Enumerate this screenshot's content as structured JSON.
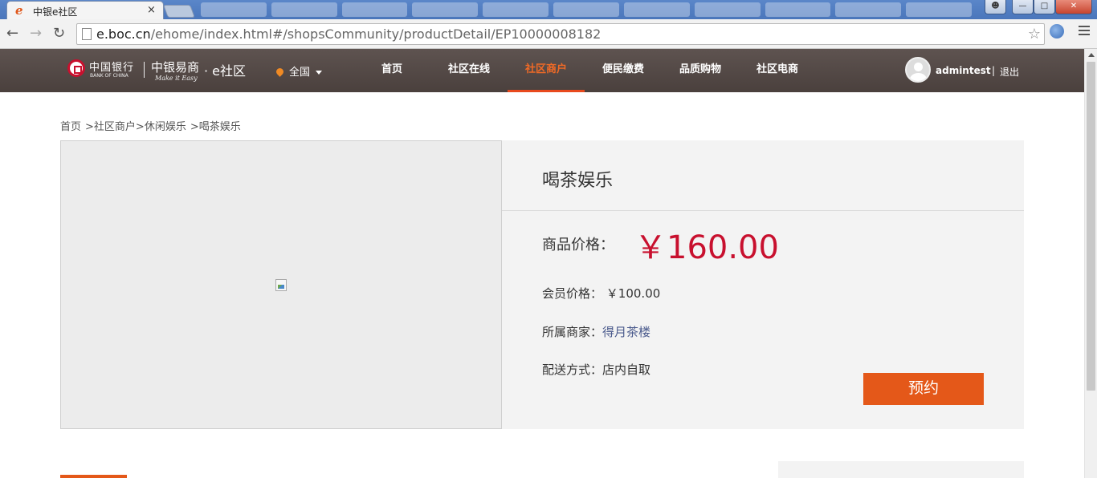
{
  "browser": {
    "tab_title": "中银e社区",
    "tab_favicon": "e",
    "tab_close": "×",
    "url_host": "e.boc.cn",
    "url_path": "/ehome/index.html#/shopsCommunity/productDetail/EP10000008182"
  },
  "header": {
    "bank_name": "中国银行",
    "bank_en": "BANK OF CHINA",
    "brand_zh": "中银易商",
    "brand_en": "Make it Easy",
    "brand_suffix": "· e社区",
    "location": "全国",
    "nav": [
      "首页",
      "社区在线",
      "社区商户",
      "便民缴费",
      "品质购物",
      "社区电商"
    ],
    "active_nav": "社区商户",
    "username": "admintest",
    "separator": "|",
    "logout": "退出"
  },
  "breadcrumb": [
    "首页",
    ">社区商户",
    ">休闲娱乐",
    ">喝茶娱乐"
  ],
  "product": {
    "title": "喝茶娱乐",
    "price_label": "商品价格：",
    "price": "￥160.00",
    "member_label": "会员价格：",
    "member_price": "￥100.00",
    "merchant_label": "所属商家：",
    "merchant": "得月茶楼",
    "delivery_label": "配送方式：",
    "delivery": "店内自取",
    "book_button": "预约"
  },
  "colors": {
    "accent": "#e45819",
    "price": "#c8102e",
    "header_bg": "#4f4542"
  }
}
